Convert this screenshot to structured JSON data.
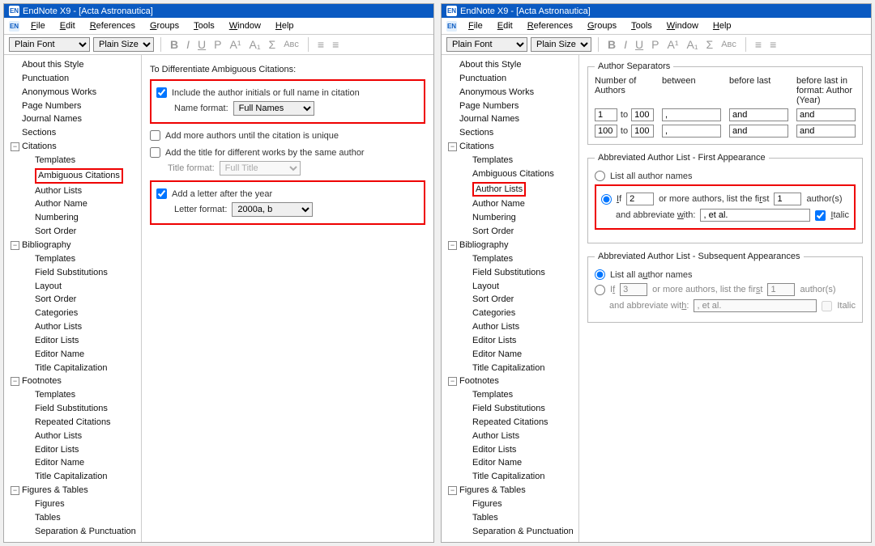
{
  "app": {
    "icon_label": "EN",
    "title": "EndNote X9 - [Acta Astronautica]"
  },
  "menu": [
    "File",
    "Edit",
    "References",
    "Groups",
    "Tools",
    "Window",
    "Help"
  ],
  "font_selector": {
    "font": "Plain Font",
    "size": "Plain Size"
  },
  "toolbar_icons": [
    "B",
    "I",
    "U",
    "P",
    "A¹",
    "A₁",
    "Σ",
    "Aʙᴄ",
    "≡",
    "≡"
  ],
  "tree": [
    {
      "l": "About this Style",
      "d": 0
    },
    {
      "l": "Punctuation",
      "d": 0
    },
    {
      "l": "Anonymous Works",
      "d": 0
    },
    {
      "l": "Page Numbers",
      "d": 0
    },
    {
      "l": "Journal Names",
      "d": 0
    },
    {
      "l": "Sections",
      "d": 0
    },
    {
      "l": "Citations",
      "d": 0,
      "e": "-"
    },
    {
      "l": "Templates",
      "d": 1
    },
    {
      "l": "Ambiguous Citations",
      "d": 1,
      "hl": "left"
    },
    {
      "l": "Author Lists",
      "d": 1,
      "hl": "right"
    },
    {
      "l": "Author Name",
      "d": 1
    },
    {
      "l": "Numbering",
      "d": 1
    },
    {
      "l": "Sort Order",
      "d": 1
    },
    {
      "l": "Bibliography",
      "d": 0,
      "e": "-"
    },
    {
      "l": "Templates",
      "d": 1
    },
    {
      "l": "Field Substitutions",
      "d": 1
    },
    {
      "l": "Layout",
      "d": 1
    },
    {
      "l": "Sort Order",
      "d": 1
    },
    {
      "l": "Categories",
      "d": 1
    },
    {
      "l": "Author Lists",
      "d": 1
    },
    {
      "l": "Editor Lists",
      "d": 1
    },
    {
      "l": "Editor Name",
      "d": 1
    },
    {
      "l": "Title Capitalization",
      "d": 1
    },
    {
      "l": "Footnotes",
      "d": 0,
      "e": "-"
    },
    {
      "l": "Templates",
      "d": 1
    },
    {
      "l": "Field Substitutions",
      "d": 1
    },
    {
      "l": "Repeated Citations",
      "d": 1
    },
    {
      "l": "Author Lists",
      "d": 1
    },
    {
      "l": "Editor Lists",
      "d": 1
    },
    {
      "l": "Editor Name",
      "d": 1
    },
    {
      "l": "Title Capitalization",
      "d": 1
    },
    {
      "l": "Figures & Tables",
      "d": 0,
      "e": "-"
    },
    {
      "l": "Figures",
      "d": 1
    },
    {
      "l": "Tables",
      "d": 1
    },
    {
      "l": "Separation & Punctuation",
      "d": 1
    }
  ],
  "left_pane": {
    "heading": "To Differentiate Ambiguous Citations:",
    "include_label": "Include the author initials or full name in citation",
    "include_checked": true,
    "name_format_label": "Name format:",
    "name_format_value": "Full Names",
    "add_more_label": "Add more authors until the citation is unique",
    "add_more_checked": false,
    "add_title_label": "Add the title for different works by the same author",
    "add_title_checked": false,
    "title_format_label": "Title format:",
    "title_format_value": "Full Title",
    "add_letter_label": "Add a letter after the year",
    "add_letter_checked": true,
    "letter_format_label": "Letter format:",
    "letter_format_value": "2000a, b"
  },
  "right_pane": {
    "sep_legend": "Author Separators",
    "headers": [
      "Number of Authors",
      "between",
      "before last",
      "before last in format: Author (Year)"
    ],
    "rows": [
      {
        "from": "1",
        "to": "100",
        "between": ",",
        "before": "and",
        "before_fmt": "and"
      },
      {
        "from": "100",
        "to": "100",
        "between": ",",
        "before": "and",
        "before_fmt": "and"
      }
    ],
    "range_to": "to",
    "first_legend": "Abbreviated Author List - First Appearance",
    "list_all": "List all author names",
    "if_radio_checked_first": true,
    "if_label_pre": "If",
    "if_label_mid": "or more authors, list the first",
    "if_label_post": "author(s)",
    "first_if_n": "2",
    "first_list_n": "1",
    "abbrev_with_label": "and abbreviate with:",
    "first_abbrev": ", et al.",
    "italic_label": "Italic",
    "first_italic_checked": true,
    "subs_legend": "Abbreviated Author List - Subsequent Appearances",
    "subs_list_all_checked": true,
    "subs_if_n": "3",
    "subs_list_n": "1",
    "subs_abbrev": ", et al.",
    "subs_italic_checked": false
  }
}
